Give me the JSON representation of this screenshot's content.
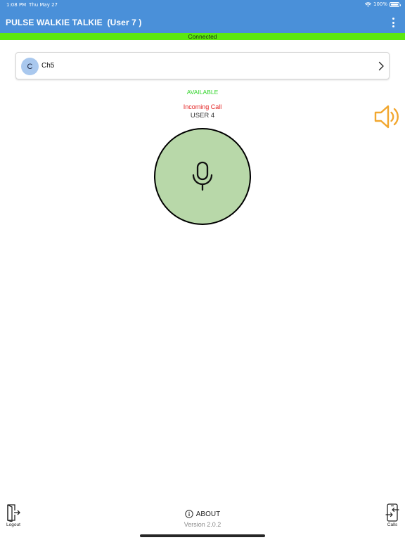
{
  "status_bar": {
    "time": "1:08 PM",
    "date": "Thu May 27",
    "battery": "100%",
    "icons": [
      "wifi-icon",
      "battery-icon"
    ]
  },
  "header": {
    "title": "PULSE WALKIE TALKIE  (User 7 )",
    "menu_icon": "more-vertical-icon",
    "background_color": "#4a90d9"
  },
  "connection": {
    "status": "Connected",
    "color": "#5ce80f"
  },
  "channel": {
    "avatar_letter": "C",
    "name": "Ch5",
    "chevron_icon": "chevron-right-icon"
  },
  "call": {
    "availability": "AVAILABLE",
    "availability_color": "#31d42a",
    "incoming_text": "Incoming Call",
    "incoming_color": "#e32222",
    "caller": "USER 4"
  },
  "speaker_icon": "speaker-volume-icon",
  "ptt": {
    "icon": "microphone-icon",
    "color": "#b8d8a9"
  },
  "footer": {
    "logout_label": "Logout",
    "logout_icon": "logout-door-icon",
    "about_label": "ABOUT",
    "about_icon": "info-icon",
    "version": "Version 2.0.2",
    "calls_label": "Calls",
    "calls_icon": "calls-phone-icon"
  }
}
